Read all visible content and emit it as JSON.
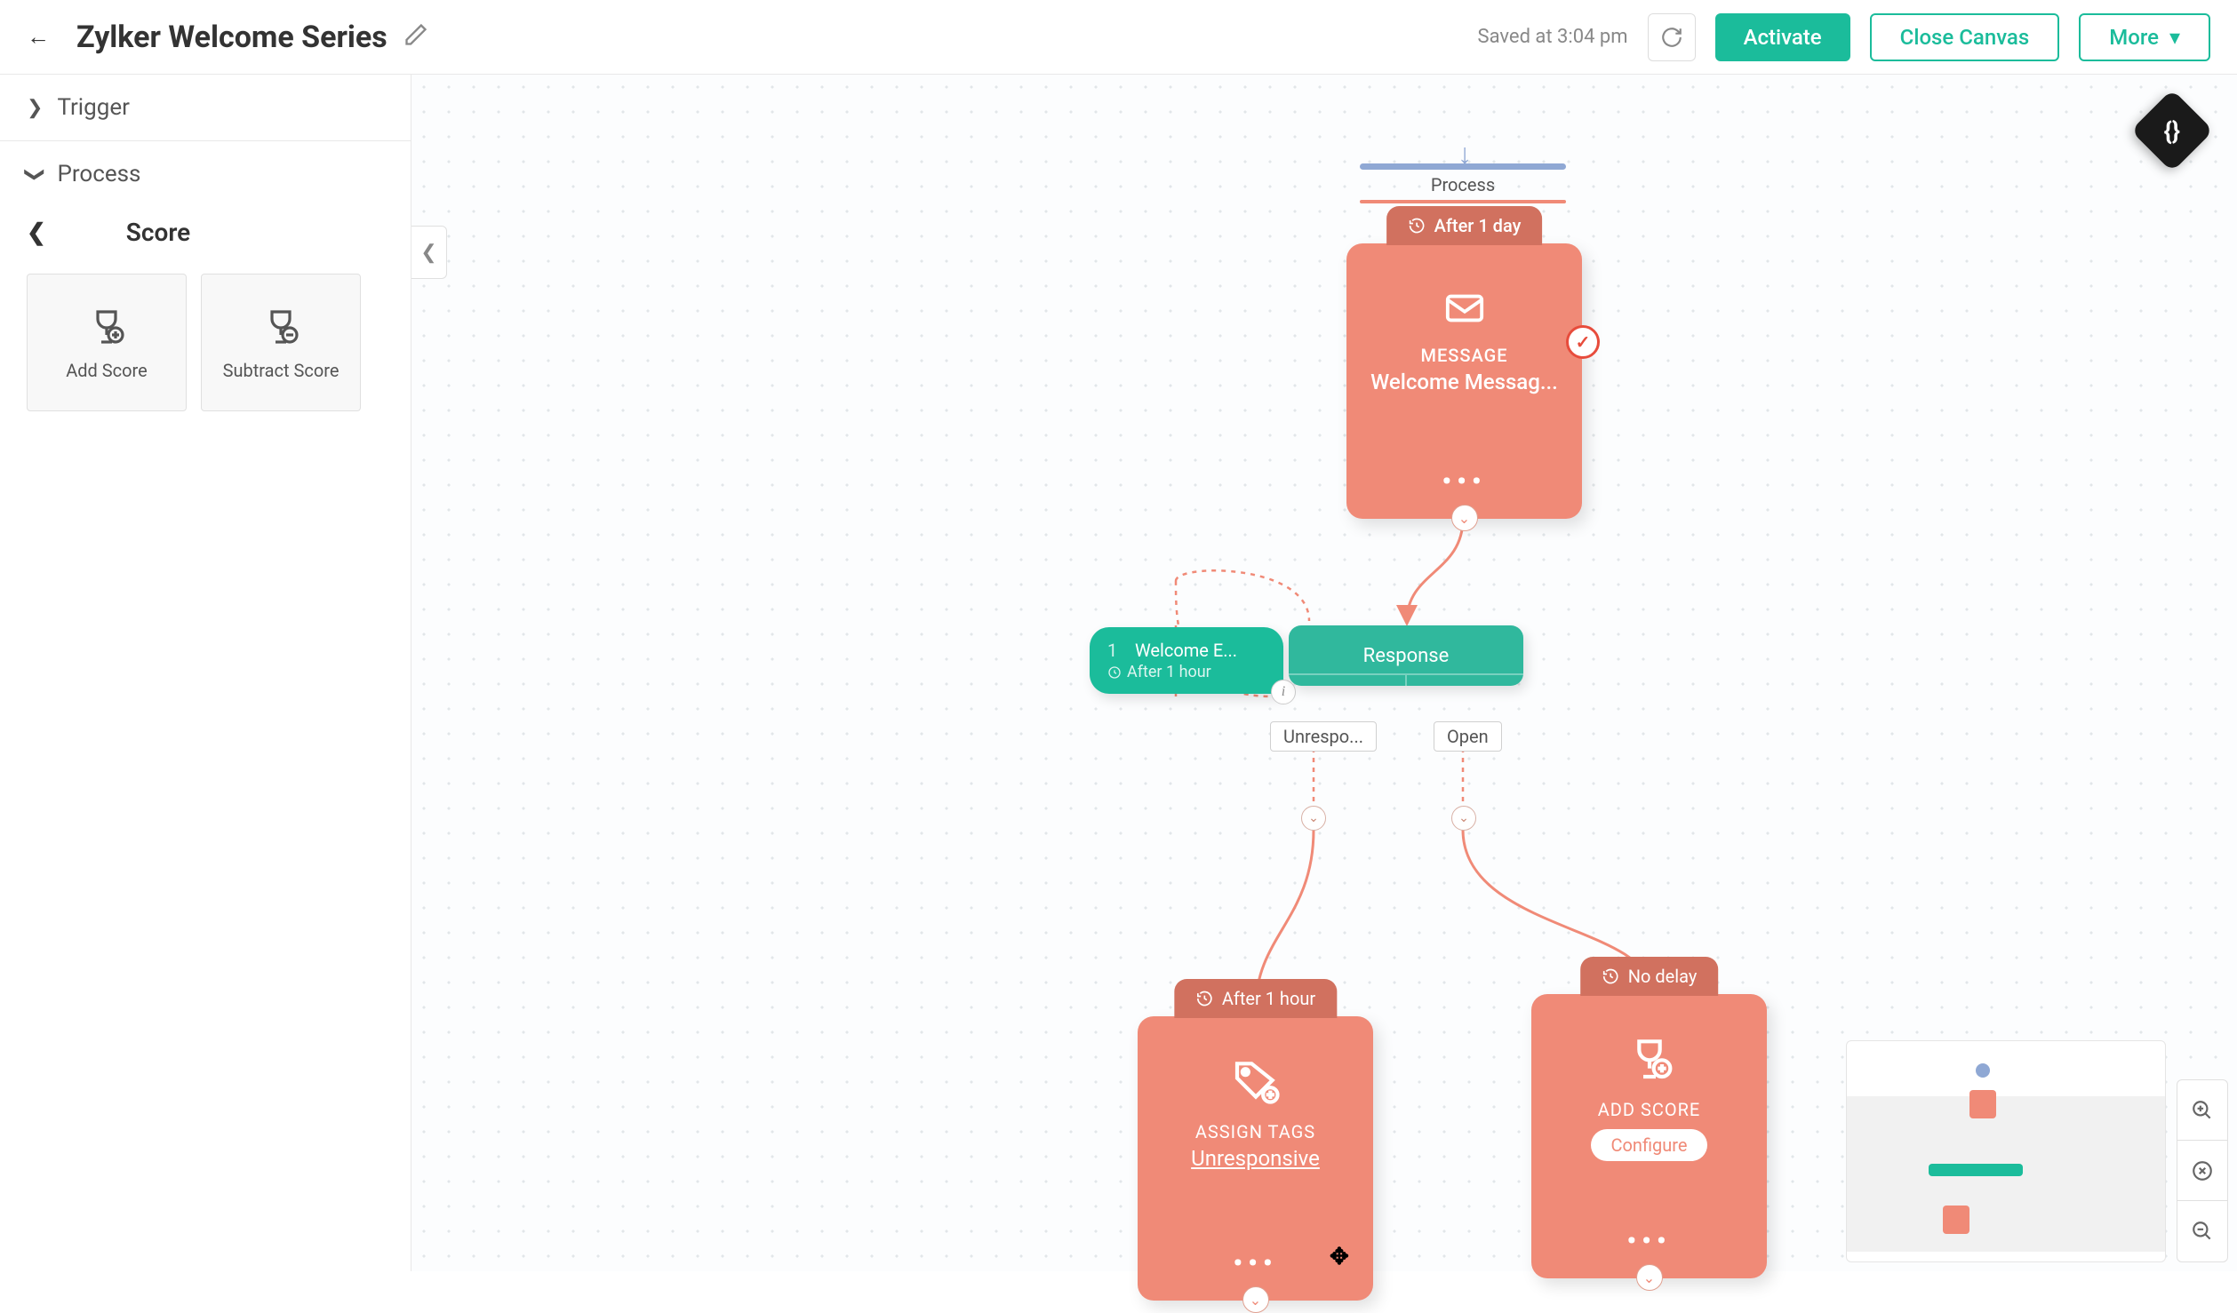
{
  "header": {
    "title": "Zylker Welcome Series",
    "saved": "Saved at 3:04 pm",
    "activate": "Activate",
    "close": "Close Canvas",
    "more": "More"
  },
  "sidebar": {
    "trigger": "Trigger",
    "process": "Process",
    "score_title": "Score",
    "tools": [
      {
        "label": "Add Score"
      },
      {
        "label": "Subtract Score"
      }
    ]
  },
  "canvas": {
    "process_label": "Process",
    "message_node": {
      "delay": "After 1 day",
      "type": "MESSAGE",
      "title": "Welcome Messag..."
    },
    "welcome_pill": {
      "num": "1",
      "title": "Welcome E...",
      "delay": "After 1 hour"
    },
    "response_node": {
      "label": "Response"
    },
    "branches": {
      "left": "Unrespo...",
      "right": "Open"
    },
    "tags_node": {
      "delay": "After 1 hour",
      "type": "ASSIGN TAGS",
      "value": "Unresponsive"
    },
    "score_node": {
      "delay": "No delay",
      "type": "ADD SCORE",
      "configure": "Configure"
    }
  }
}
